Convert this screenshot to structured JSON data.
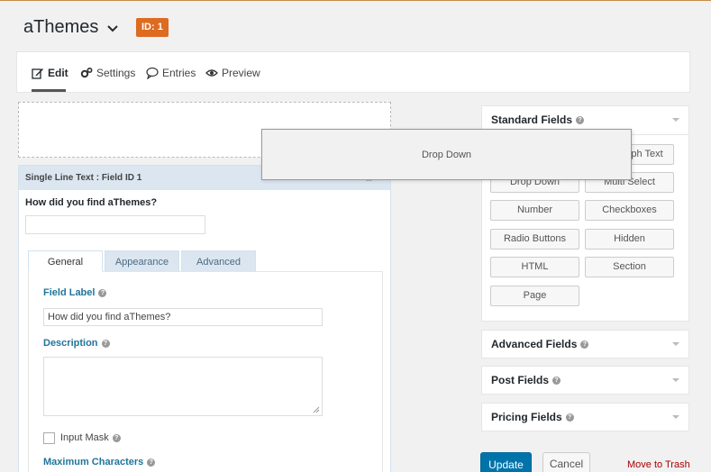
{
  "header": {
    "title": "aThemes",
    "id_badge": "ID: 1"
  },
  "toolbar": {
    "items": [
      {
        "label": "Edit",
        "icon": "edit-icon"
      },
      {
        "label": "Settings",
        "icon": "gear-icon"
      },
      {
        "label": "Entries",
        "icon": "comment-icon"
      },
      {
        "label": "Preview",
        "icon": "eye-icon"
      }
    ]
  },
  "field": {
    "header": "Single Line Text : Field ID 1",
    "question": "How did you find aThemes?",
    "tabs": [
      "General",
      "Appearance",
      "Advanced"
    ],
    "field_label_title": "Field Label",
    "field_label_value": "How did you find aThemes?",
    "description_title": "Description",
    "input_mask_label": "Input Mask",
    "max_chars_title": "Maximum Characters"
  },
  "drag_helper": {
    "label": "Drop Down"
  },
  "standard_fields": {
    "title": "Standard Fields",
    "buttons": [
      "Paragraph Text",
      "Drop Down",
      "Multi Select",
      "Number",
      "Checkboxes",
      "Radio Buttons",
      "Hidden",
      "HTML",
      "Section",
      "Page"
    ]
  },
  "panels": {
    "advanced": "Advanced Fields",
    "post": "Post Fields",
    "pricing": "Pricing Fields"
  },
  "actions": {
    "update": "Update",
    "cancel": "Cancel",
    "trash": "Move to Trash"
  }
}
